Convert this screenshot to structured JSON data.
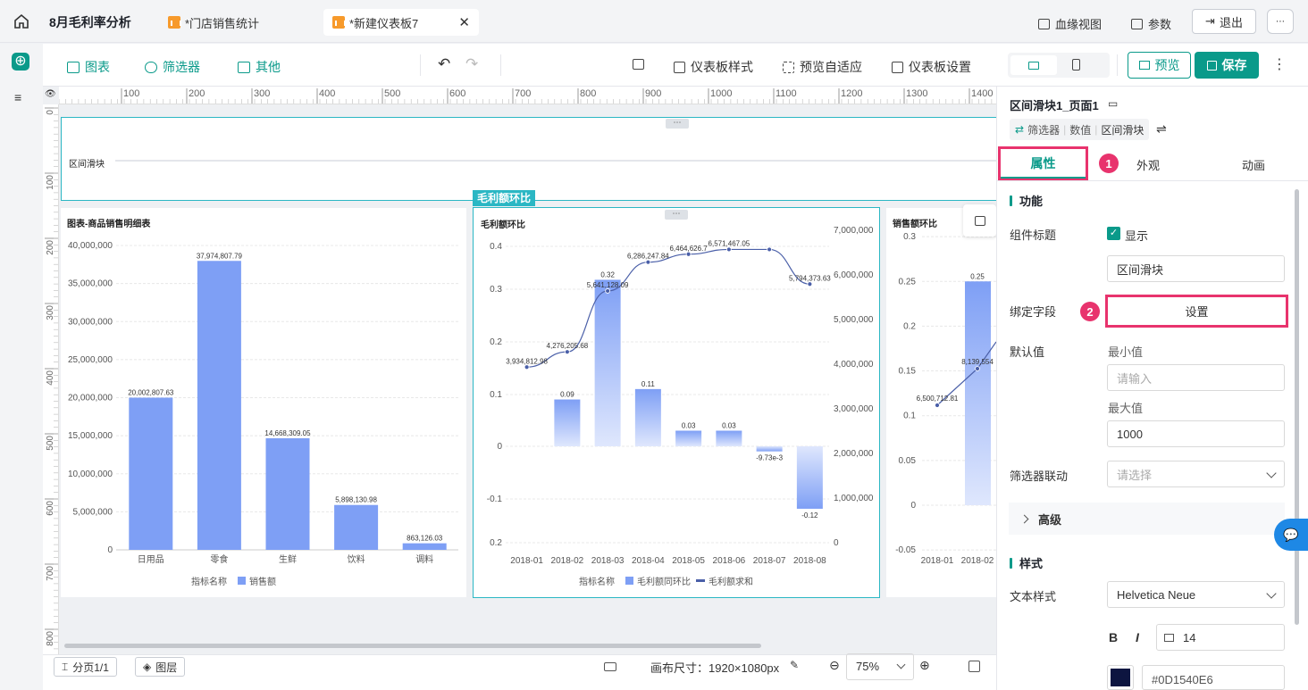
{
  "topbar": {
    "title": "8月毛利率分析",
    "tabs": [
      {
        "label": "*门店销售统计"
      },
      {
        "label": "*新建仪表板7"
      }
    ],
    "lineage": "血缘视图",
    "params": "参数",
    "exit": "退出"
  },
  "toolbar": {
    "chart": "图表",
    "filter": "筛选器",
    "other": "其他",
    "style": "仪表板样式",
    "preview_fit": "预览自适应",
    "settings": "仪表板设置",
    "preview": "预览",
    "save": "保存"
  },
  "ruler": {
    "top": [
      "100",
      "200",
      "300",
      "400",
      "500",
      "600",
      "700",
      "800",
      "900",
      "1000",
      "1100",
      "1200",
      "1300",
      "1400"
    ],
    "left": [
      "0",
      "100",
      "200",
      "300",
      "400",
      "500",
      "600",
      "700",
      "800"
    ]
  },
  "slider_widget": {
    "label": "区间滑块"
  },
  "chart1": {
    "title": "图表-商品销售明细表",
    "legend_title": "指标名称",
    "legend_item": "销售额"
  },
  "chart2": {
    "title": "毛利额环比",
    "tag": "毛利额环比",
    "legend_title": "指标名称",
    "legend_bar": "毛利额同环比",
    "legend_line": "毛利额求和"
  },
  "chart3": {
    "title": "销售额环比"
  },
  "chart_data": [
    {
      "type": "bar",
      "title": "图表-商品销售明细表",
      "categories": [
        "日用品",
        "零食",
        "生鲜",
        "饮料",
        "调料"
      ],
      "series": [
        {
          "name": "销售额",
          "values": [
            20002807.63,
            37974807.79,
            14668309.05,
            5898130.98,
            863126.03
          ]
        }
      ],
      "value_labels": [
        "20,002,807.63",
        "37,974,807.79",
        "14,668,309.05",
        "5,898,130.98",
        "863,126.03"
      ],
      "yticks": [
        "40,000,000",
        "35,000,000",
        "30,000,000",
        "25,000,000",
        "20,000,000",
        "15,000,000",
        "10,000,000",
        "5,000,000",
        "0"
      ],
      "ylim": [
        0,
        40000000
      ],
      "xlabel": "",
      "ylabel": ""
    },
    {
      "type": "bar",
      "title": "毛利额环比",
      "categories": [
        "2018-01",
        "2018-02",
        "2018-03",
        "2018-04",
        "2018-05",
        "2018-06",
        "2018-07",
        "2018-08"
      ],
      "series": [
        {
          "name": "毛利额同环比",
          "values": [
            null,
            0.09,
            0.32,
            0.11,
            0.03,
            0.03,
            -0.00973,
            -0.12
          ],
          "labels": [
            "",
            "0.09",
            "0.32",
            "0.11",
            "0.03",
            "0.03",
            "-9.73e-3",
            "-0.12"
          ]
        },
        {
          "name": "毛利额求和",
          "type": "line",
          "values": [
            3934812.98,
            4276205.68,
            5641128.09,
            6286247.84,
            6464626.7,
            6571467.05,
            6571467.05,
            5794373.63
          ],
          "labels": [
            "3,934,812.98",
            "4,276,205.68",
            "5,641,128.09",
            "6,286,247.84",
            "6,464,626.7",
            "6,571,467.05",
            "",
            "5,794,373.63"
          ]
        }
      ],
      "yticks_left": [
        "0.4",
        "0.3",
        "0.2",
        "0.1",
        "0",
        "-0.1",
        "0.2"
      ],
      "yticks_right": [
        "7,000,000",
        "6,000,000",
        "5,000,000",
        "4,000,000",
        "3,000,000",
        "2,000,000",
        "1,000,000",
        "0"
      ],
      "ylim_left": [
        -0.2,
        0.4
      ],
      "ylim_right": [
        0,
        7000000
      ]
    },
    {
      "type": "bar",
      "title": "销售额环比",
      "categories": [
        "2018-01",
        "2018-02"
      ],
      "series": [
        {
          "name": "bar",
          "values": [
            null,
            0.25
          ],
          "labels": [
            "",
            "0.25"
          ]
        },
        {
          "name": "line",
          "type": "line",
          "values": [
            6500712.81,
            8139554
          ],
          "labels": [
            "6,500,712.81",
            "8,139,554"
          ]
        }
      ],
      "yticks_left": [
        "0.3",
        "0.25",
        "0.2",
        "0.15",
        "0.1",
        "0.05",
        "0",
        "-0.05"
      ]
    }
  ],
  "panel": {
    "header": "区间滑块1_页面1",
    "crumbs": [
      "筛选器",
      "数值",
      "区间滑块"
    ],
    "tabs": {
      "props": "属性",
      "appearance": "外观",
      "animation": "动画"
    },
    "section_func": "功能",
    "comp_title_label": "组件标题",
    "show": "显示",
    "title_value": "区间滑块",
    "bind_label": "绑定字段",
    "bind_button": "设置",
    "default_label": "默认值",
    "min_label": "最小值",
    "min_placeholder": "请输入",
    "max_label": "最大值",
    "max_value": "1000",
    "link_label": "筛选器联动",
    "link_placeholder": "请选择",
    "advanced": "高级",
    "section_style": "样式",
    "text_style_label": "文本样式",
    "font_value": "Helvetica Neue",
    "font_size": "14",
    "color_value": "#0D1540E6",
    "badge1": "1",
    "badge2": "2"
  },
  "bottom": {
    "pages": "分页1/1",
    "layers": "图层",
    "canvas_size": "画布尺寸：1920×1080px",
    "zoom": "75%"
  },
  "colors": {
    "accent": "#0a9a8a",
    "bar": "#7e9ff5",
    "highlight": "#e8336d"
  }
}
